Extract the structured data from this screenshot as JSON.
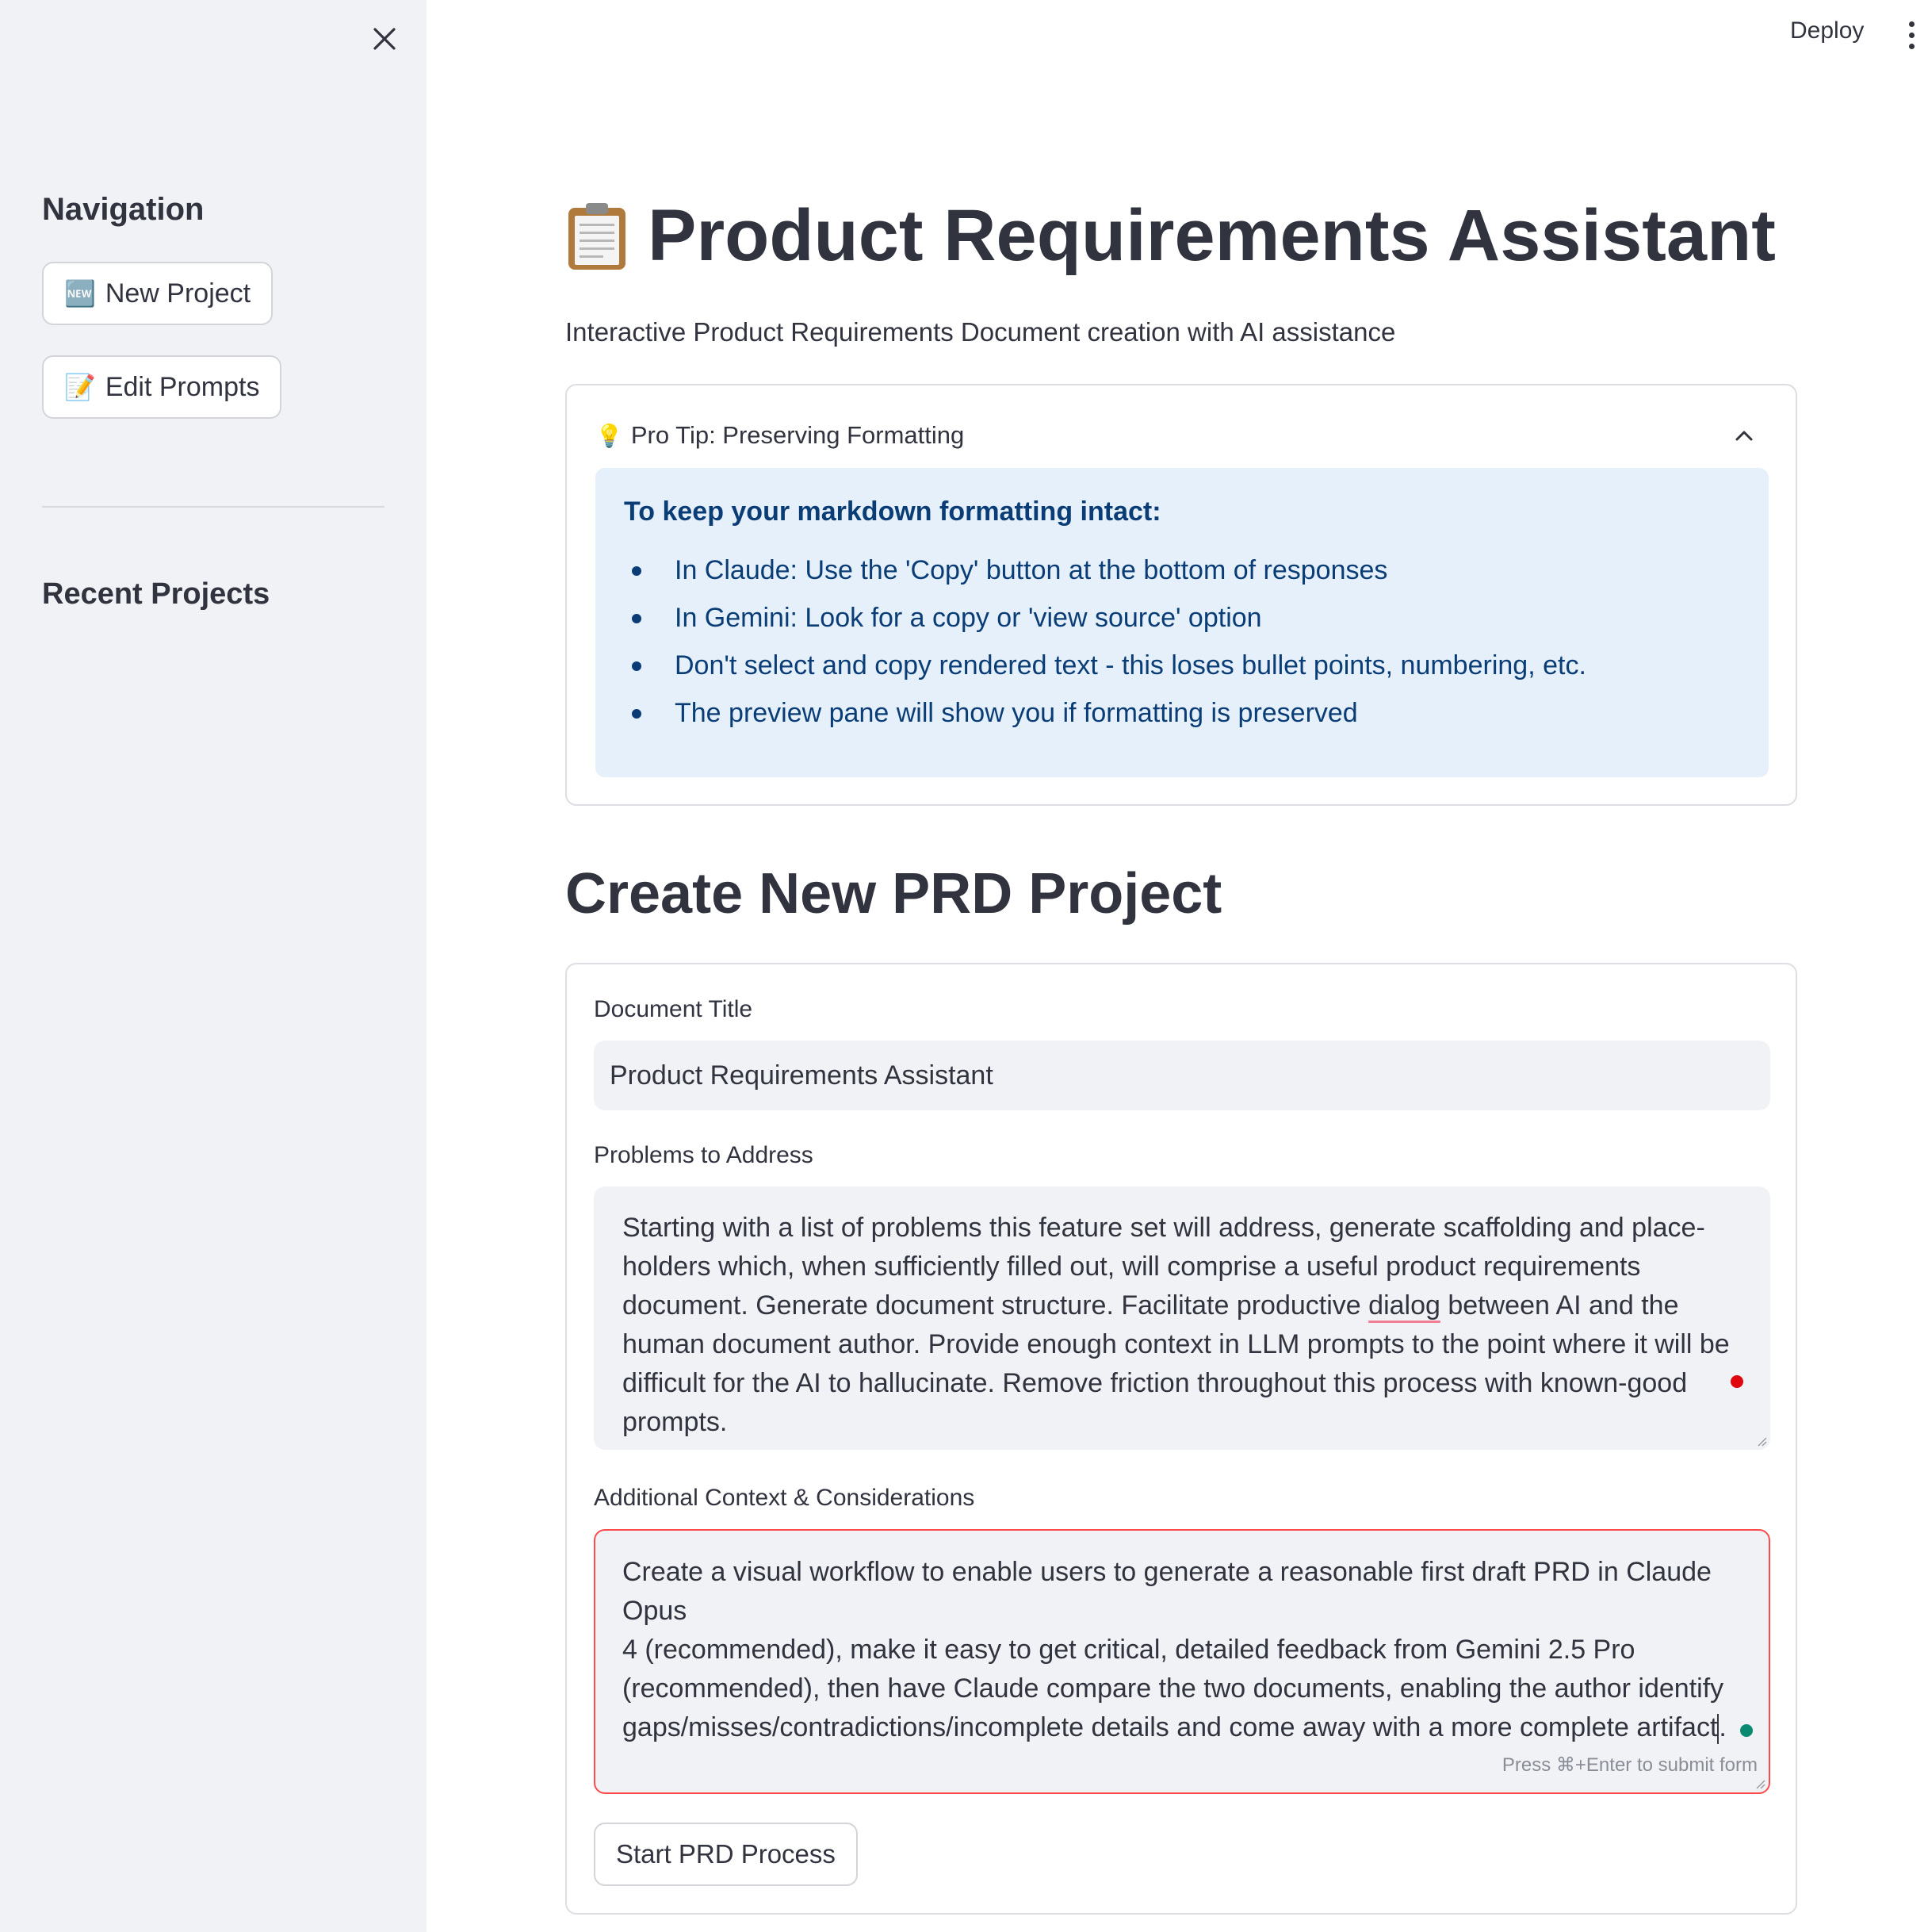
{
  "header": {
    "deploy_label": "Deploy"
  },
  "sidebar": {
    "navigation_heading": "Navigation",
    "buttons": [
      {
        "emoji": "🆕",
        "label": "New Project"
      },
      {
        "emoji": "📝",
        "label": "Edit Prompts"
      }
    ],
    "recent_heading": "Recent Projects"
  },
  "main": {
    "title": "Product Requirements Assistant",
    "subtitle": "Interactive Product Requirements Document creation with AI assistance",
    "tip": {
      "emoji": "💡",
      "header": "Pro Tip: Preserving Formatting",
      "title": "To keep your markdown formatting intact:",
      "items": [
        "In Claude: Use the 'Copy' button at the bottom of responses",
        "In Gemini: Look for a copy or 'view source' option",
        "Don't select and copy rendered text - this loses bullet points, numbering, etc.",
        "The preview pane will show you if formatting is preserved"
      ]
    },
    "section_title": "Create New PRD Project",
    "form": {
      "doc_title_label": "Document Title",
      "doc_title_value": "Product Requirements Assistant",
      "problems_label": "Problems to Address",
      "problems_lines": [
        "Starting with a list of problems this feature set will address, generate scaffolding and place-",
        "holders which, when sufficiently filled out, will comprise a useful product requirements",
        "document. Generate document structure. Facilitate productive ",
        "dialog",
        " between AI and the",
        "human document author. Provide enough context in LLM prompts to the point where it will be",
        "difficult for the AI to hallucinate. Remove friction throughout this process with known-good",
        "prompts."
      ],
      "context_label": "Additional Context & Considerations",
      "context_lines": [
        "Create a visual workflow to enable users to generate a reasonable first draft PRD in Claude Opus",
        "4 (recommended), make it easy to get critical, detailed feedback from Gemini 2.5 Pro",
        "(recommended), then have Claude compare the two documents, enabling the author identify",
        "gaps/misses/contradictions/incomplete details and come away with a more complete artifact",
        "."
      ],
      "context_hint": "Press ⌘+Enter to submit form",
      "submit_label": "Start PRD Process"
    }
  }
}
